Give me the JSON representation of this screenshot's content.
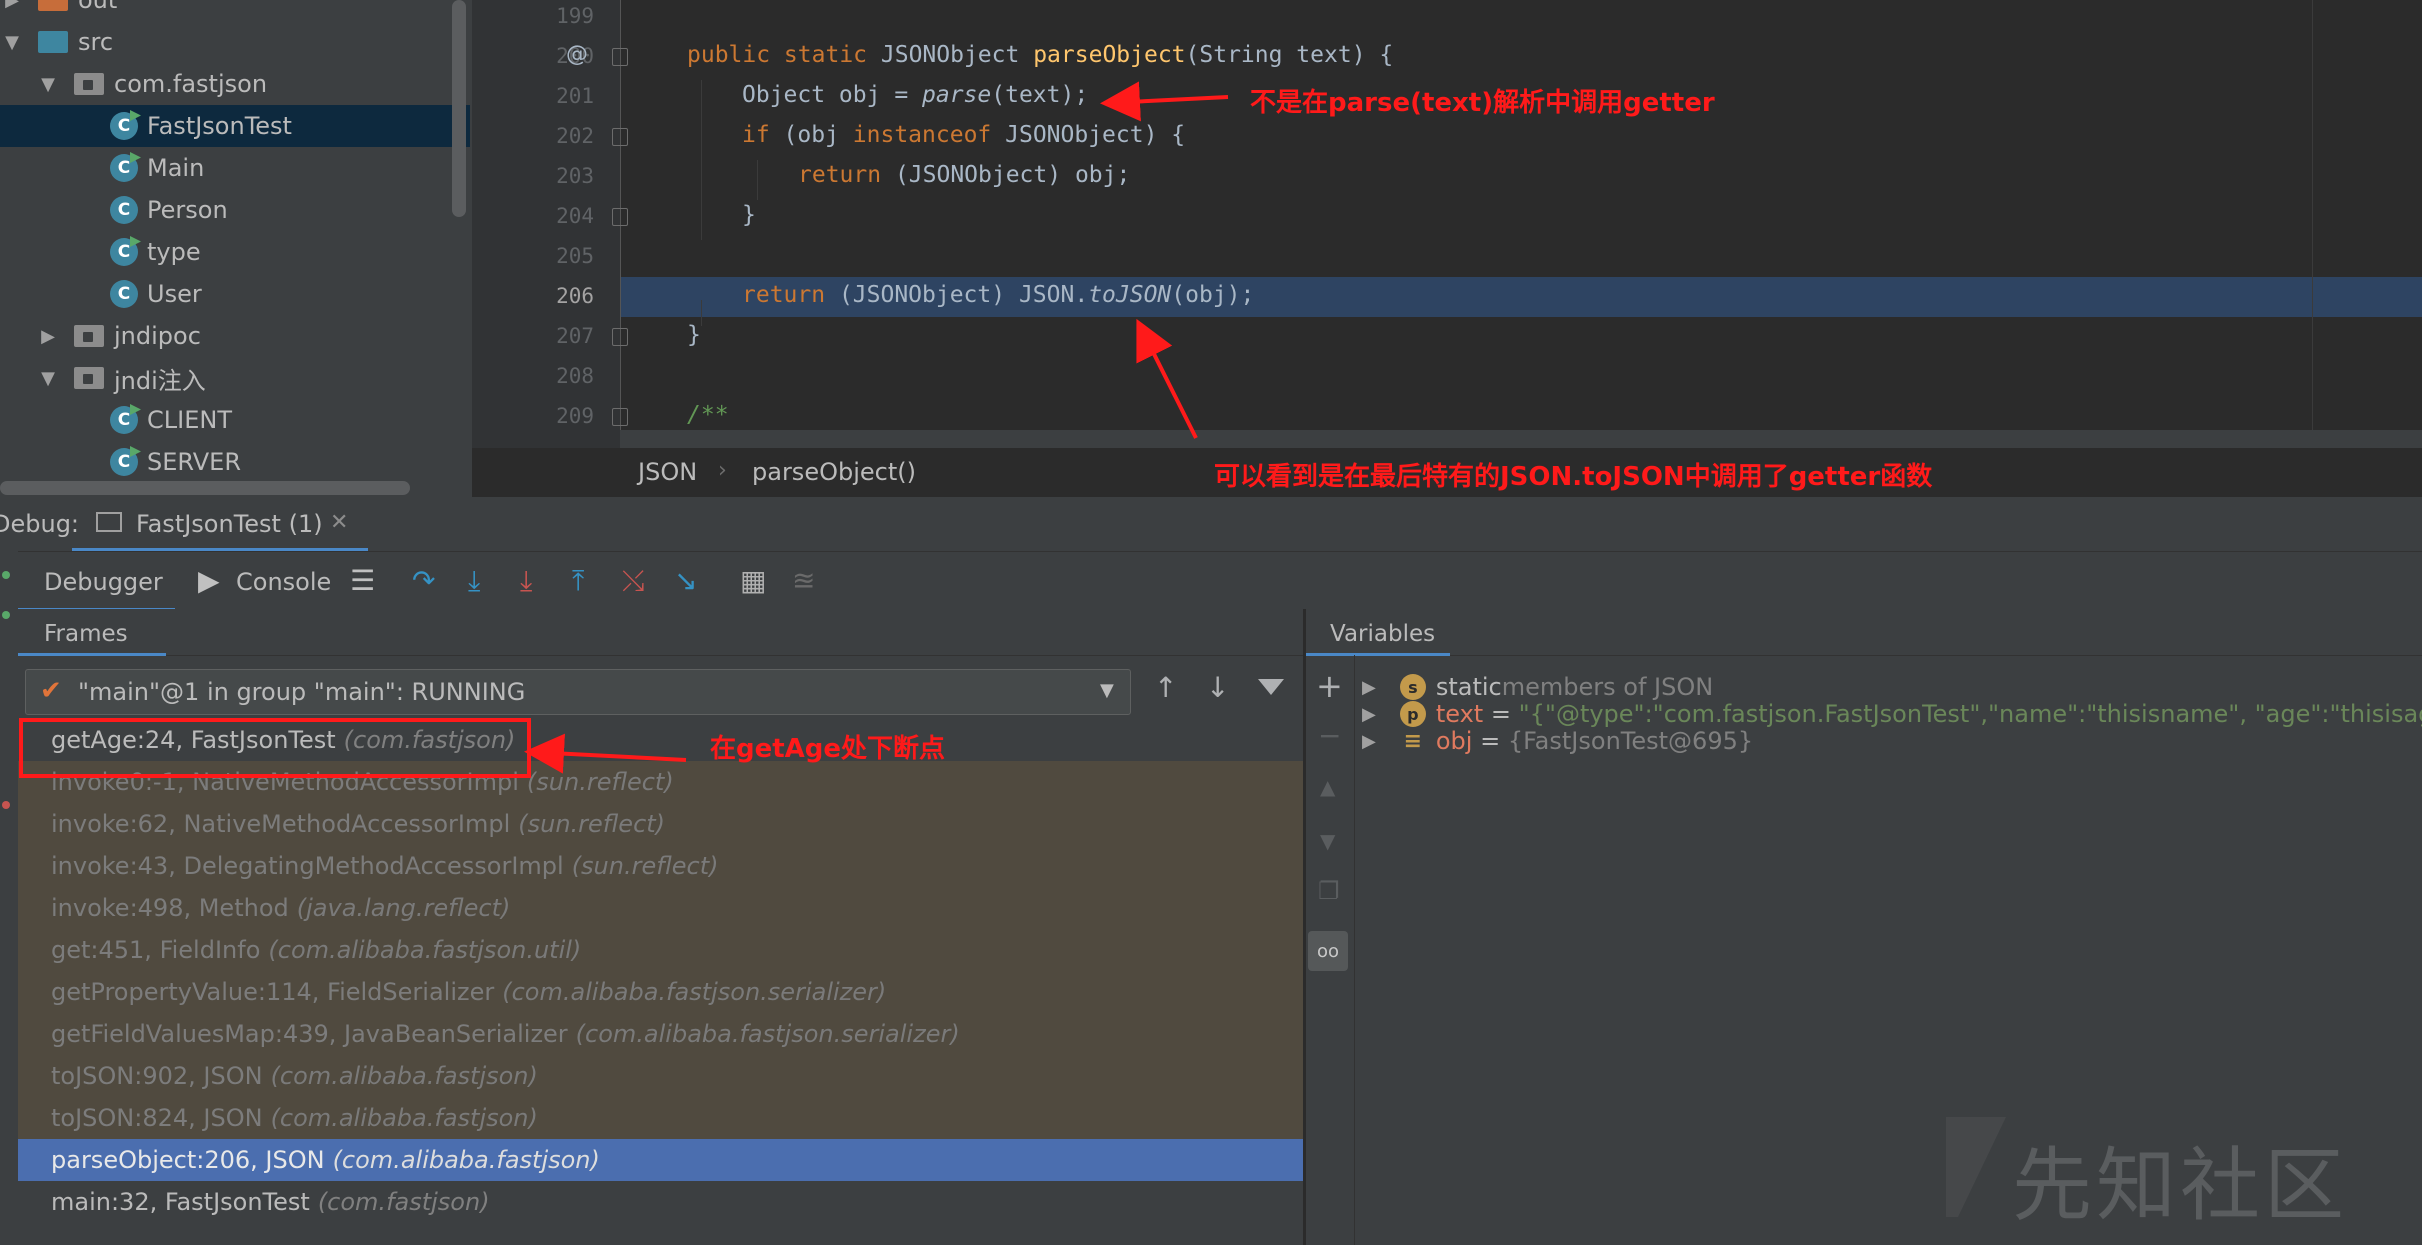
{
  "project_tree": {
    "items": [
      {
        "label": "out",
        "kind": "folder-orange",
        "expanded": false
      },
      {
        "label": "src",
        "kind": "folder-blue",
        "expanded": true
      },
      {
        "label": "com.fastjson",
        "kind": "package",
        "expanded": true
      },
      {
        "label": "FastJsonTest",
        "kind": "class-run",
        "selected": true
      },
      {
        "label": "Main",
        "kind": "class-run"
      },
      {
        "label": "Person",
        "kind": "class"
      },
      {
        "label": "type",
        "kind": "class-run"
      },
      {
        "label": "User",
        "kind": "class"
      },
      {
        "label": "jndipoc",
        "kind": "package",
        "expanded": false
      },
      {
        "label": "jndi注入",
        "kind": "package",
        "expanded": true
      },
      {
        "label": "CLIENT",
        "kind": "class-run"
      },
      {
        "label": "SERVER",
        "kind": "class-run"
      }
    ]
  },
  "editor": {
    "line_numbers": [
      "199",
      "200",
      "201",
      "202",
      "203",
      "204",
      "205",
      "206",
      "207",
      "208",
      "209"
    ],
    "current_line": "206",
    "gutter_marker": "@",
    "code": {
      "l200_kw": "public static ",
      "l200_type": "JSONObject ",
      "l200_fn": "parseObject",
      "l200_rest": "(String text) {",
      "l201_a": "Object obj = ",
      "l201_call": "parse",
      "l201_b": "(text);",
      "l202_kw": "if ",
      "l202_a": "(obj ",
      "l202_kw2": "instanceof ",
      "l202_b": "JSONObject) {",
      "l203_kw": "return ",
      "l203_a": "(JSONObject) obj;",
      "l204": "}",
      "l206_kw": "return ",
      "l206_a": "(JSONObject) JSON.",
      "l206_call": "toJSON",
      "l206_b": "(obj);",
      "l207": "}",
      "l209": "/**"
    },
    "breadcrumb": [
      "JSON",
      "parseObject()"
    ]
  },
  "annotations": {
    "a1": "不是在parse(text)解析中调用getter",
    "a2": "可以看到是在最后特有的JSON.toJSON中调用了getter函数",
    "a3": "在getAge处下断点",
    "color": "#ff1a1a"
  },
  "debug": {
    "label": "Debug:",
    "session_tab": "FastJsonTest (1)",
    "tabs": {
      "debugger": "Debugger",
      "console": "Console"
    },
    "frames_header": "Frames",
    "variables_header": "Variables",
    "thread_selector": "\"main\"@1 in group \"main\": RUNNING",
    "frames": [
      {
        "method": "getAge:24, FastJsonTest",
        "pkg": "(com.fastjson)",
        "style": "top"
      },
      {
        "method": "invoke0:-1, NativeMethodAccessorImpl",
        "pkg": "(sun.reflect)",
        "style": "lib"
      },
      {
        "method": "invoke:62, NativeMethodAccessorImpl",
        "pkg": "(sun.reflect)",
        "style": "lib"
      },
      {
        "method": "invoke:43, DelegatingMethodAccessorImpl",
        "pkg": "(sun.reflect)",
        "style": "lib"
      },
      {
        "method": "invoke:498, Method",
        "pkg": "(java.lang.reflect)",
        "style": "lib"
      },
      {
        "method": "get:451, FieldInfo",
        "pkg": "(com.alibaba.fastjson.util)",
        "style": "lib"
      },
      {
        "method": "getPropertyValue:114, FieldSerializer",
        "pkg": "(com.alibaba.fastjson.serializer)",
        "style": "lib"
      },
      {
        "method": "getFieldValuesMap:439, JavaBeanSerializer",
        "pkg": "(com.alibaba.fastjson.serializer)",
        "style": "lib"
      },
      {
        "method": "toJSON:902, JSON",
        "pkg": "(com.alibaba.fastjson)",
        "style": "lib"
      },
      {
        "method": "toJSON:824, JSON",
        "pkg": "(com.alibaba.fastjson)",
        "style": "lib"
      },
      {
        "method": "parseObject:206, JSON",
        "pkg": "(com.alibaba.fastjson)",
        "style": "cur"
      },
      {
        "method": "main:32, FastJsonTest",
        "pkg": "(com.fastjson)",
        "style": "top"
      }
    ],
    "variables": [
      {
        "badge": "s",
        "name": "static",
        "value": " members of JSON"
      },
      {
        "badge": "p",
        "name": "text",
        "eq": " = ",
        "value": "\"{\"@type\":\"com.fastjson.FastJsonTest\",\"name\":\"thisisname\", \"age\":\"thisisage\"}\""
      },
      {
        "badge": "≡",
        "name": "obj",
        "eq": " = ",
        "value": "{FastJsonTest@695}"
      }
    ]
  },
  "watermark": "先知社区",
  "colors": {
    "tree_bg": "#3c3f41",
    "editor_bg": "#2b2b2b",
    "selection": "#4b6eaf",
    "keyword": "#cc7832",
    "function": "#ffc66d",
    "string": "#6a8759"
  }
}
